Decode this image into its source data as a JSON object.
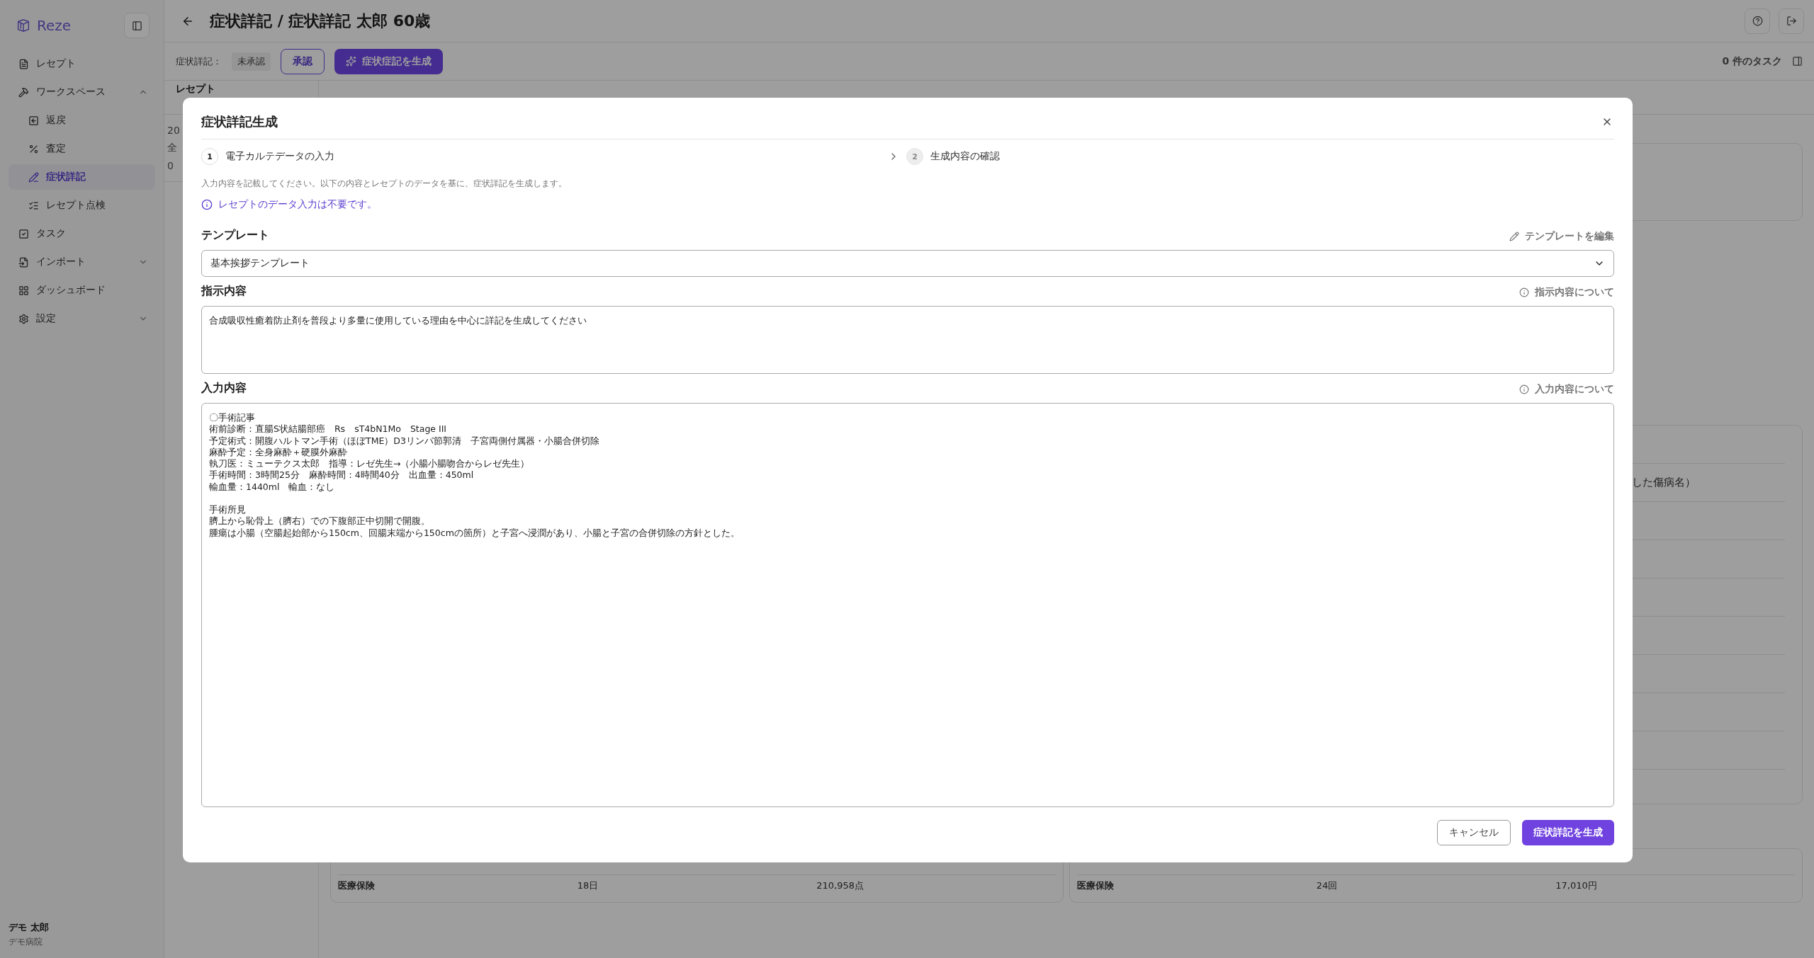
{
  "sidebar": {
    "logo": "Reze",
    "items": [
      {
        "kind": "link",
        "label": "レセプト",
        "selected": false
      },
      {
        "kind": "group",
        "label": "ワークスペース",
        "selected": false,
        "expanded": true,
        "children": [
          {
            "label": "返戻",
            "selected": false
          },
          {
            "label": "査定",
            "selected": false
          },
          {
            "label": "症状詳記",
            "selected": true
          },
          {
            "label": "レセプト点検",
            "selected": false
          }
        ]
      },
      {
        "kind": "link",
        "label": "タスク",
        "selected": false
      },
      {
        "kind": "group",
        "label": "インポート",
        "selected": false,
        "expanded": false
      },
      {
        "kind": "link",
        "label": "ダッシュボード",
        "selected": false
      },
      {
        "kind": "group",
        "label": "設定",
        "selected": false,
        "expanded": false
      }
    ],
    "user": {
      "name": "デモ 太郎",
      "org": "デモ病院"
    }
  },
  "header": {
    "title": "症状詳記 / 症状詳記 太郎 60歳"
  },
  "toolbar": {
    "status_label": "症状詳記：",
    "status": "未承認",
    "approve_button": "承認",
    "generate_button": "症状症記を生成",
    "tasks": "0 件のタスク"
  },
  "list_panel": {
    "title": "レセプト",
    "rows": [
      "20",
      "全",
      "0"
    ]
  },
  "content": {
    "fragment": "した傷病名）",
    "summary": [
      {
        "cells": [
          "医療保険",
          "18日",
          "210,958点"
        ]
      },
      {
        "cells": [
          "医療保険",
          "24回",
          "17,010円"
        ]
      }
    ]
  },
  "modal": {
    "title": "症状詳記生成",
    "steps": [
      {
        "number": "1",
        "label": "電子カルテデータの入力",
        "selected": true
      },
      {
        "number": "2",
        "label": "生成内容の確認",
        "selected": false
      }
    ],
    "description": "入力内容を記載してください。以下の内容とレセプトのデータを基に、症状詳記を生成します。",
    "notice": "レセプトのデータ入力は不要です。",
    "template": {
      "label": "テンプレート",
      "action": "テンプレートを編集",
      "value": "基本挨拶テンプレート"
    },
    "instruction": {
      "label": "指示内容",
      "help": "指示内容について",
      "value": "合成吸収性癒着防止剤を普段より多量に使用している理由を中心に詳記を生成してください"
    },
    "input": {
      "label": "入力内容",
      "help": "入力内容について",
      "paragraphs": [
        [
          "〇手術記事",
          "術前診断：直腸S状結腸部癌　Rs　sT4bN1Mo　Stage III",
          "予定術式：開腹ハルトマン手術（ほぼTME）D3リンパ節郭清　子宮両側付属器・小腸合併切除",
          "麻酔予定：全身麻酔＋硬膜外麻酔",
          "執刀医：ミューテクス太郎　指導：レゼ先生→（小腸小腸吻合からレゼ先生）",
          "手術時間：3時間25分　麻酔時間：4時間40分　出血量：450ml",
          "輸血量：1440ml　輸血：なし"
        ],
        [
          "手術所見",
          "臍上から恥骨上（臍右）での下腹部正中切開で開腹。",
          "腫瘍は小腸（空腸起始部から150cm、回腸末端から150cmの箇所）と子宮へ浸潤があり、小腸と子宮の合併切除の方針とした。"
        ]
      ]
    },
    "buttons": {
      "cancel": "キャンセル",
      "submit": "症状詳記を生成"
    }
  }
}
